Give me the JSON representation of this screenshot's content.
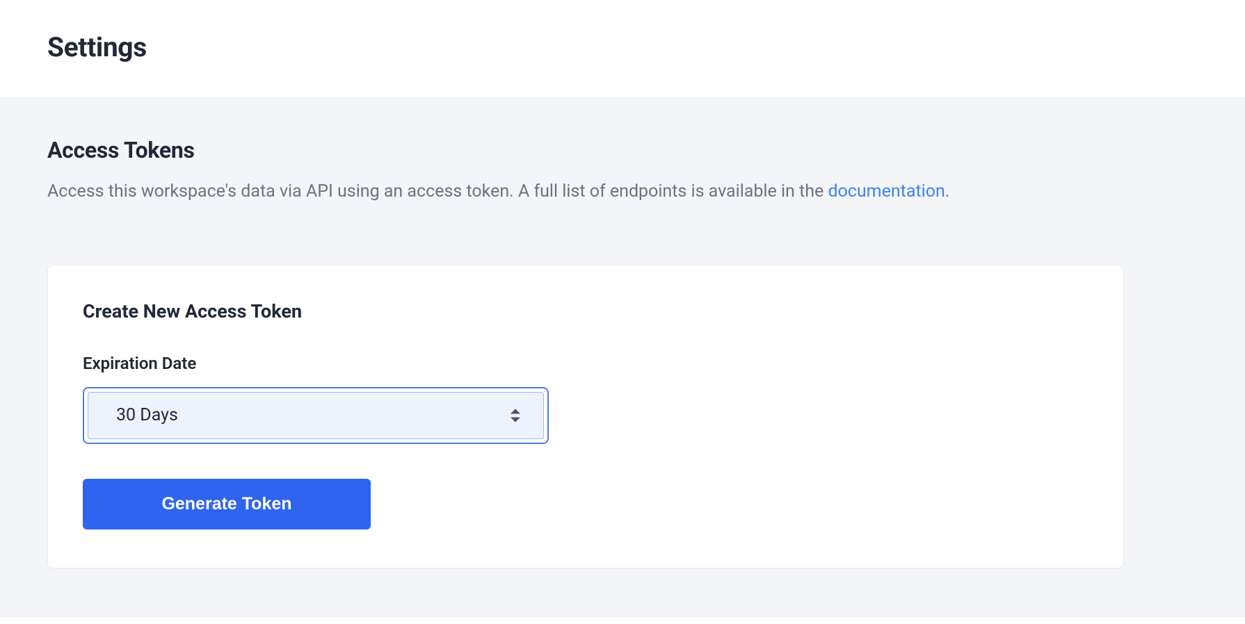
{
  "header": {
    "title": "Settings"
  },
  "section": {
    "title": "Access Tokens",
    "description_prefix": "Access this workspace's data via API using an access token. A full list of endpoints is available in the ",
    "description_link": "documentation",
    "description_suffix": "."
  },
  "card": {
    "title": "Create New Access Token",
    "expiration_label": "Expiration Date",
    "expiration_value": "30 Days",
    "generate_button": "Generate Token"
  }
}
